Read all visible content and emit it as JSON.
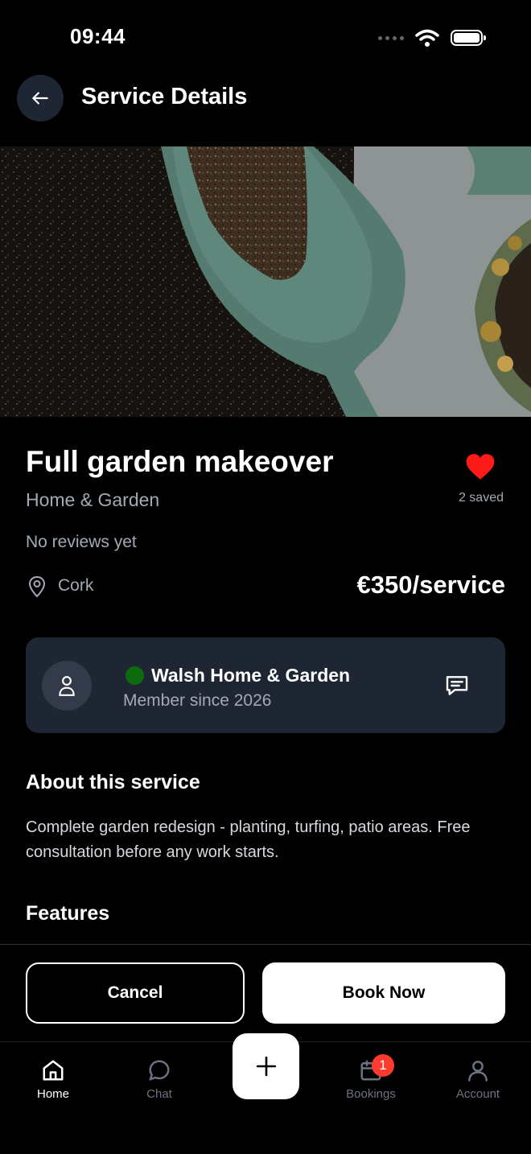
{
  "status_bar": {
    "time": "09:44"
  },
  "header": {
    "title": "Service Details",
    "back_icon": "arrow-left-icon"
  },
  "service": {
    "title": "Full garden makeover",
    "category": "Home & Garden",
    "saved_count": "2 saved",
    "reviews": "No reviews yet",
    "location": "Cork",
    "price": "€350/service",
    "favorite": true
  },
  "provider": {
    "name": "Walsh Home & Garden",
    "member_since": "Member since 2026",
    "online": true
  },
  "about": {
    "heading": "About this service",
    "description": "Complete garden redesign - planting, turfing, patio areas. Free consultation before any work starts."
  },
  "features": {
    "heading": "Features"
  },
  "actions": {
    "cancel_label": "Cancel",
    "book_label": "Book Now"
  },
  "nav": {
    "items": [
      {
        "label": "Home",
        "icon": "home-icon",
        "active": true
      },
      {
        "label": "Chat",
        "icon": "chat-icon",
        "active": false
      },
      {
        "label": "Bookings",
        "icon": "calendar-icon",
        "active": false,
        "badge": "1"
      },
      {
        "label": "Account",
        "icon": "user-icon",
        "active": false
      }
    ],
    "fab_icon": "plus-icon"
  },
  "colors": {
    "background": "#000000",
    "card": "#1e2533",
    "muted_text": "#a3a9b5",
    "heart": "#ff1a1a",
    "online": "#0d6b0d",
    "badge": "#ff3b30"
  }
}
